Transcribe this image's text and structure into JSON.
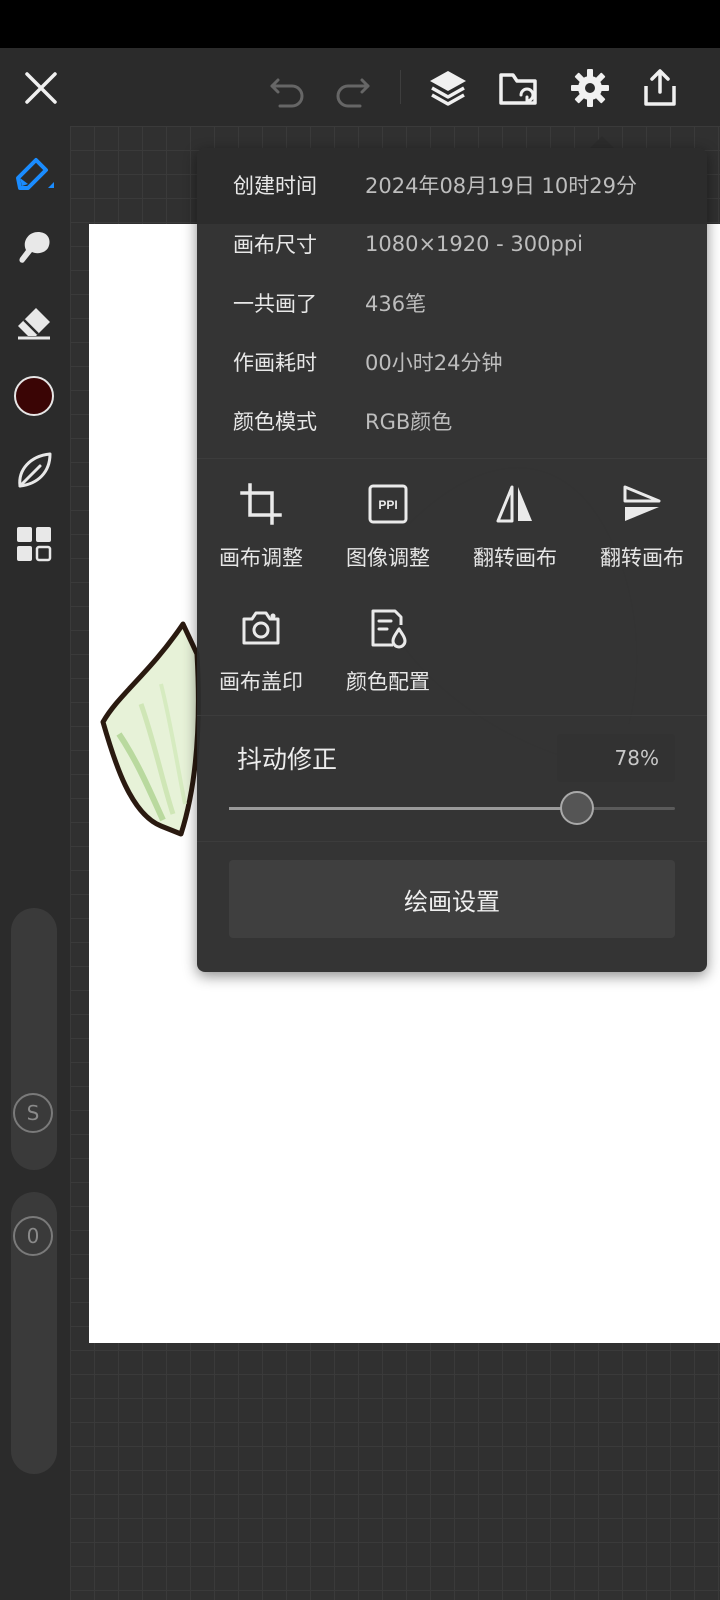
{
  "info": [
    {
      "label": "创建时间",
      "value": "2024年08月19日 10时29分"
    },
    {
      "label": "画布尺寸",
      "value": "1080×1920 - 300ppi"
    },
    {
      "label": "一共画了",
      "value": "436笔"
    },
    {
      "label": "作画耗时",
      "value": "00小时24分钟"
    },
    {
      "label": "颜色模式",
      "value": "RGB颜色"
    }
  ],
  "actions": [
    {
      "label": "画布调整",
      "icon": "crop-icon"
    },
    {
      "label": "图像调整",
      "icon": "ppi-icon"
    },
    {
      "label": "翻转画布",
      "icon": "flip-horizontal-icon"
    },
    {
      "label": "翻转画布",
      "icon": "flip-vertical-icon"
    },
    {
      "label": "画布盖印",
      "icon": "camera-icon"
    },
    {
      "label": "颜色配置",
      "icon": "color-profile-icon"
    }
  ],
  "ppi_icon_text": "PPI",
  "stabilization": {
    "label": "抖动修正",
    "value_text": "78%",
    "value": 0.78
  },
  "drawing_settings_label": "绘画设置",
  "side_controls": {
    "size_label": "S",
    "opacity_label": "0"
  },
  "current_color": "#3a0505",
  "accent_color": "#1a8cff"
}
